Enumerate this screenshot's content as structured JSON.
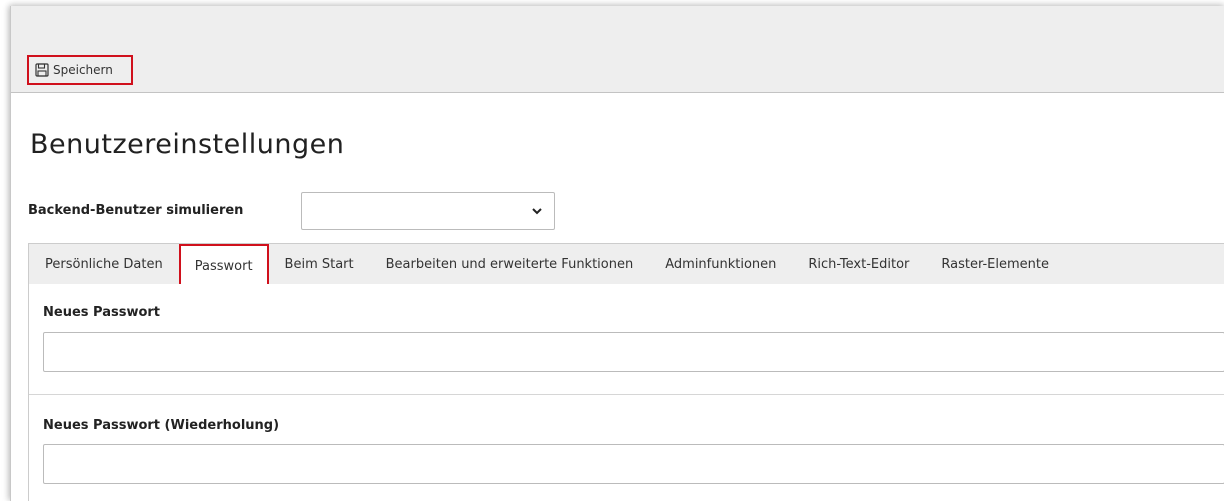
{
  "toolbar": {
    "save_label": "Speichern",
    "save_icon": "floppy-disk-icon"
  },
  "page": {
    "title": "Benutzereinstellungen"
  },
  "simulate": {
    "label": "Backend-Benutzer simulieren",
    "value": ""
  },
  "tabs": [
    {
      "label": "Persönliche Daten",
      "active": false
    },
    {
      "label": "Passwort",
      "active": true
    },
    {
      "label": "Beim Start",
      "active": false
    },
    {
      "label": "Bearbeiten und erweiterte Funktionen",
      "active": false
    },
    {
      "label": "Adminfunktionen",
      "active": false
    },
    {
      "label": "Rich-Text-Editor",
      "active": false
    },
    {
      "label": "Raster-Elemente",
      "active": false
    }
  ],
  "form": {
    "new_password_label": "Neues Passwort",
    "new_password_value": "",
    "repeat_password_label": "Neues Passwort (Wiederholung)",
    "repeat_password_value": ""
  },
  "colors": {
    "highlight": "#d0101c",
    "header_bg": "#eeeeee"
  }
}
